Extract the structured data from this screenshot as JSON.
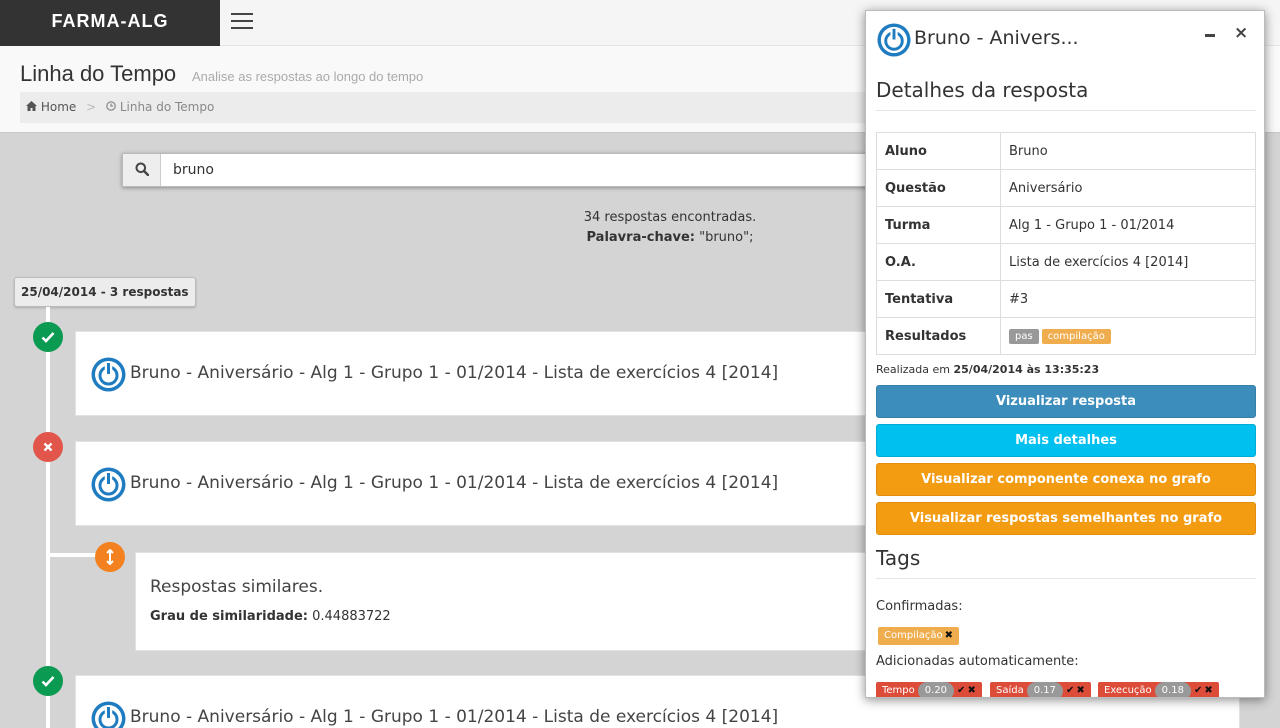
{
  "app": {
    "logo": "FARMA-ALG"
  },
  "page": {
    "title": "Linha do Tempo",
    "subtitle": "Analise as respostas ao longo do tempo",
    "breadcrumb": {
      "home": "Home",
      "current": "Linha do Tempo"
    }
  },
  "search": {
    "value": "bruno"
  },
  "results": {
    "count_text": "34 respostas encontradas.",
    "keyword_label": "Palavra-chave:",
    "keyword_value": "\"bruno\";"
  },
  "timeline": {
    "date_badge": "25/04/2014 - 3 respostas",
    "items": [
      {
        "status": "success",
        "text": "Bruno - Aniversário - Alg 1 - Grupo 1 - 01/2014 - Lista de exercícios 4 [2014]"
      },
      {
        "status": "error",
        "text": "Bruno - Aniversário - Alg 1 - Grupo 1 - 01/2014 - Lista de exercícios 4 [2014]"
      },
      {
        "status": "success",
        "text": "Bruno - Aniversário - Alg 1 - Grupo 1 - 01/2014 - Lista de exercícios 4 [2014]"
      }
    ],
    "similar": {
      "title": "Respostas similares.",
      "degree_label": "Grau de similaridade:",
      "degree_value": "0.44883722"
    }
  },
  "panel": {
    "title": "Bruno - Anivers...",
    "details_title": "Detalhes da resposta",
    "rows": [
      {
        "key": "Aluno",
        "value": "Bruno"
      },
      {
        "key": "Questão",
        "value": "Aniversário"
      },
      {
        "key": "Turma",
        "value": "Alg 1 - Grupo 1 - 01/2014"
      },
      {
        "key": "O.A.",
        "value": "Lista de exercícios 4 [2014]"
      },
      {
        "key": "Tentativa",
        "value": "#3"
      },
      {
        "key": "Resultados",
        "labels": [
          "pas",
          "compilação"
        ]
      }
    ],
    "realizada_label": "Realizada em",
    "realizada_value": "25/04/2014 às 13:35:23",
    "buttons": {
      "view": "Vizualizar resposta",
      "more": "Mais detalhes",
      "graph_component": "Visualizar componente conexa no grafo",
      "graph_similar": "Visualizar respostas semelhantes no grafo"
    },
    "tags_title": "Tags",
    "confirmed_label": "Confirmadas:",
    "confirmed_tags": [
      "Compilação"
    ],
    "auto_label": "Adicionadas automaticamente:",
    "auto_tags": [
      {
        "name": "Tempo",
        "score": "0.20"
      },
      {
        "name": "Saída",
        "score": "0.17"
      },
      {
        "name": "Execução",
        "score": "0.18"
      }
    ]
  },
  "colors": {
    "success": "#0a9a52",
    "error": "#e1554a",
    "similar": "#f4811f",
    "primary": "#3c8dbc",
    "info": "#00c0ef",
    "warning": "#f39c12",
    "logo_bg": "#333333"
  }
}
